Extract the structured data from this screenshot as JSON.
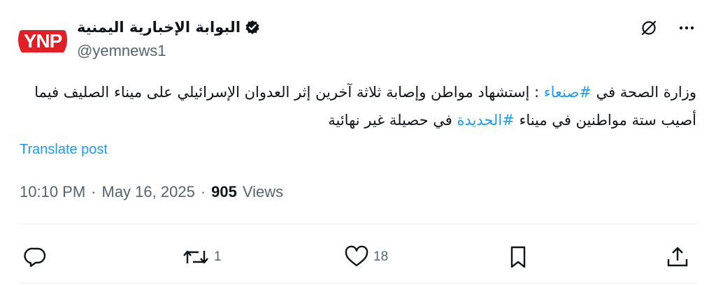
{
  "author": {
    "display_name": "البوابة الإخبارية اليمنية",
    "handle": "@yemnews1",
    "avatar_text": "YNP",
    "avatar_icon": "ynp-logo",
    "verified_icon": "verified-badge-icon"
  },
  "header_icons": [
    "grok-icon",
    "more-icon"
  ],
  "post": {
    "line1_part1": "وزارة الصحة في ",
    "hashtag1": "#صنعاء",
    "line1_part2": " : إستشهاد مواطن وإصابة ثلاثة آخرين إثر العدوان الإسرائيلي على ميناء الصليف فيما أصيب ستة مواطنين في ميناء ",
    "hashtag2": "#الحديدة",
    "line2_part2": " في حصيلة غير نهائية"
  },
  "translate_label": "Translate post",
  "meta": {
    "time": "10:10 PM",
    "date": "May 16, 2025",
    "separator": "·",
    "views_count": "905",
    "views_label": "Views"
  },
  "actions": {
    "reply": {
      "icon": "reply-icon",
      "count": ""
    },
    "repost": {
      "icon": "repost-icon",
      "count": "1"
    },
    "like": {
      "icon": "like-icon",
      "count": "18"
    },
    "bookmark": {
      "icon": "bookmark-icon",
      "count": ""
    },
    "share": {
      "icon": "share-icon",
      "count": ""
    }
  },
  "colors": {
    "accent": "#1d9bf0",
    "text_primary": "#0f1419",
    "text_secondary": "#536471",
    "logo_red": "#e01f26"
  }
}
